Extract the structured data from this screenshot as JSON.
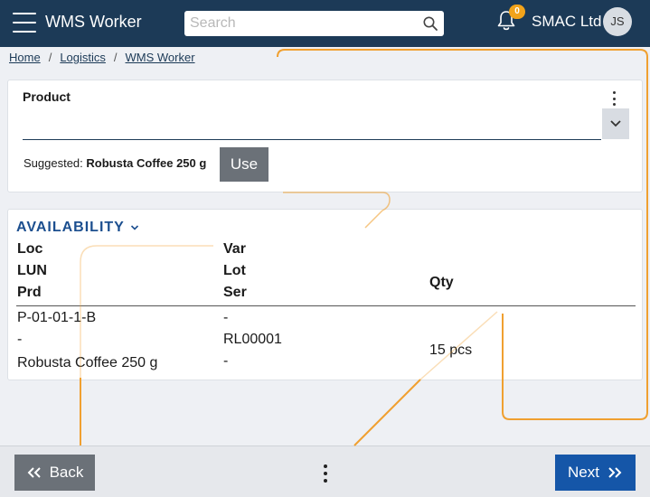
{
  "header": {
    "app_title": "WMS Worker",
    "search_placeholder": "Search",
    "notification_count": "0",
    "company": "SMAC Ltd",
    "user_initials": "JS"
  },
  "breadcrumb": [
    {
      "label": "Home"
    },
    {
      "label": "Logistics"
    },
    {
      "label": "WMS Worker"
    }
  ],
  "breadcrumb_separator": "/",
  "product": {
    "label": "Product",
    "value": "",
    "suggested_prefix": "Suggested:",
    "suggested_value": "Robusta Coffee 250 g",
    "use_label": "Use"
  },
  "availability": {
    "title": "AVAILABILITY",
    "headers": {
      "loc": "Loc",
      "lun": "LUN",
      "prd": "Prd",
      "var": "Var",
      "lot": "Lot",
      "ser": "Ser",
      "qty": "Qty"
    },
    "row": {
      "loc": "P-01-01-1-B",
      "lun": "-",
      "prd": "Robusta Coffee 250 g",
      "var": "-",
      "lot": "RL00001",
      "ser": "-",
      "qty": "15 pcs"
    }
  },
  "footer": {
    "back_label": "Back",
    "next_label": "Next"
  },
  "colors": {
    "header_bg": "#1c3a57",
    "accent_blue": "#1556a8",
    "badge": "#f2a31a",
    "overlay_line": "#f0a030"
  }
}
